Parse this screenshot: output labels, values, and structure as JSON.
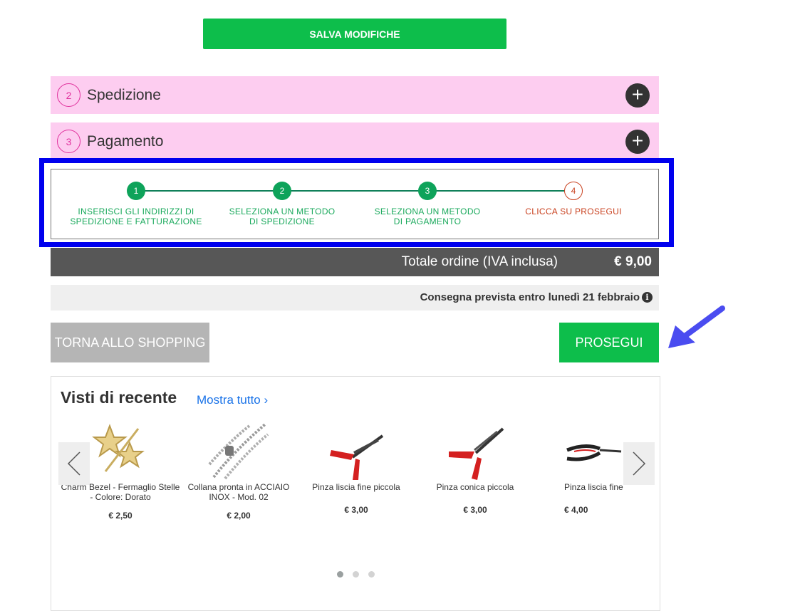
{
  "save_button": "SALVA MODIFICHE",
  "accordion": [
    {
      "number": "2",
      "title": "Spedizione",
      "icon": "plus-icon"
    },
    {
      "number": "3",
      "title": "Pagamento",
      "icon": "plus-icon"
    }
  ],
  "steps": [
    {
      "number": "1",
      "label": "INSERISCI GLI INDIRIZZI DI SPEDIZIONE E FATTURAZIONE",
      "status": "done"
    },
    {
      "number": "2",
      "label": "SELEZIONA UN METODO DI SPEDIZIONE",
      "status": "done"
    },
    {
      "number": "3",
      "label": "SELEZIONA UN METODO DI PAGAMENTO",
      "status": "done"
    },
    {
      "number": "4",
      "label": "CLICCA SU PROSEGUI",
      "status": "current"
    }
  ],
  "total": {
    "label": "Totale ordine (IVA inclusa)",
    "amount": "€ 9,00"
  },
  "delivery": {
    "text": "Consegna prevista entro lunedì 21 febbraio",
    "icon": "info-icon"
  },
  "buttons": {
    "back": "TORNA ALLO SHOPPING",
    "next": "PROSEGUI"
  },
  "recent": {
    "title": "Visti di recente",
    "more": "Mostra tutto ›",
    "products": [
      {
        "name": "Charm Bezel - Fermaglio Stelle - Colore: Dorato",
        "price": "€ 2,50",
        "image": "star-hairclip-image"
      },
      {
        "name": "Collana pronta in ACCIAIO INOX - Mod. 02",
        "price": "€ 2,00",
        "image": "steel-chain-image"
      },
      {
        "name": "Pinza liscia fine piccola",
        "price": "€ 3,00",
        "image": "pliers-image"
      },
      {
        "name": "Pinza conica piccola",
        "price": "€ 3,00",
        "image": "pliers-image"
      },
      {
        "name": "Pinza liscia fine",
        "price": "€ 4,00",
        "image": "pliers-image"
      }
    ]
  },
  "colors": {
    "green": "#0dbe4b",
    "pink": "#fdcdf0",
    "step_green": "#0ea35a",
    "step_current": "#c9411f",
    "highlight_blue": "#0000ee",
    "arrow_blue": "#4a4cf0"
  }
}
